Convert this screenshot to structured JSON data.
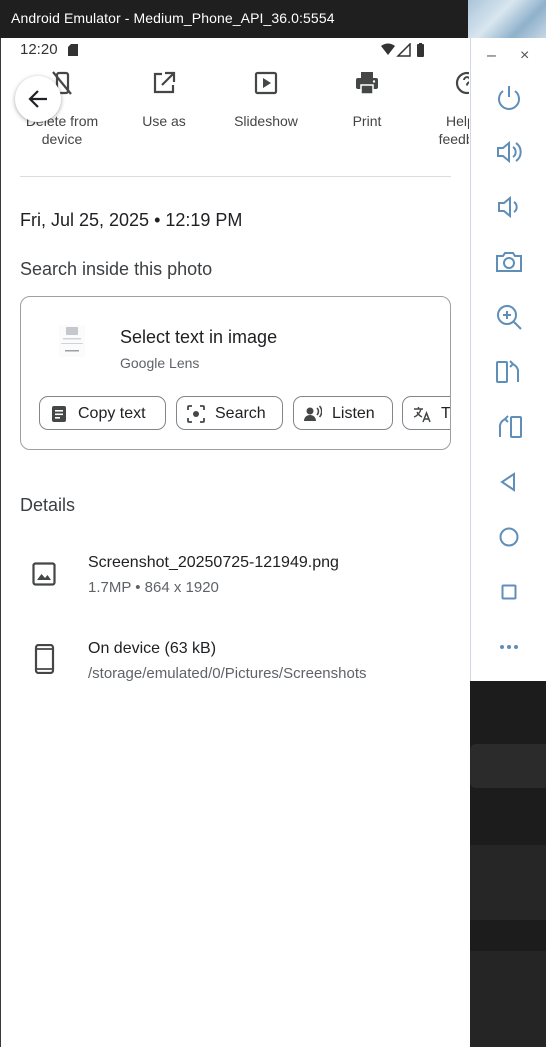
{
  "window": {
    "title": "Android Emulator - Medium_Phone_API_36.0:5554",
    "minimize": "–",
    "close": "×"
  },
  "status_bar": {
    "time": "12:20"
  },
  "actions": [
    {
      "label": "Delete from device",
      "icon": "delete-from-device-icon"
    },
    {
      "label": "Use as",
      "icon": "open-in-new-icon"
    },
    {
      "label": "Slideshow",
      "icon": "slideshow-icon"
    },
    {
      "label": "Print",
      "icon": "print-icon"
    },
    {
      "label": "Help & feedback",
      "icon": "help-icon"
    }
  ],
  "date_line": "Fri, Jul 25, 2025 • 12:19 PM",
  "search_inside": {
    "title": "Search inside this photo",
    "card_title": "Select text in image",
    "card_subtitle": "Google Lens",
    "chips": [
      "Copy text",
      "Search",
      "Listen",
      "Translate"
    ]
  },
  "details": {
    "title": "Details",
    "file": {
      "name": "Screenshot_20250725-121949.png",
      "meta": "1.7MP  •  864 x 1920"
    },
    "storage": {
      "location": "On device (63 kB)",
      "path": "/storage/emulated/0/Pictures/Screenshots"
    }
  },
  "colors": {
    "titlebar": "#1f1f1f",
    "icon": "#444746",
    "toolbar_icon": "#5f8fb9",
    "chip_border": "#80868b"
  }
}
